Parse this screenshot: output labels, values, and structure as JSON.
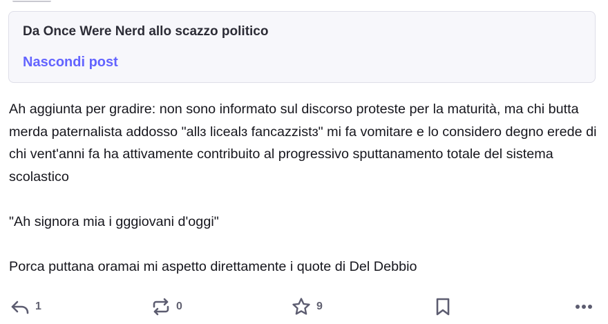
{
  "content_warning": {
    "text": "Da Once Were Nerd allo scazzo politico",
    "toggle_label": "Nascondi post"
  },
  "post": {
    "paragraphs": [
      "Ah aggiunta per gradire: non sono informato sul discorso proteste per la maturità, ma chi butta merda paternalista addosso \"allɜ licealɜ fancazzistɜ\" mi fa vomitare e lo considero degno erede di chi vent'anni fa ha attivamente contribuito al progressivo sputtanamento totale del sistema scolastico",
      "\"Ah signora mia i gggiovani d'oggi\"",
      "Porca puttana oramai mi aspetto direttamente i quote di Del Debbio"
    ]
  },
  "actions": {
    "reply": {
      "icon": "reply-icon",
      "count": "1"
    },
    "boost": {
      "icon": "boost-icon",
      "count": "0"
    },
    "favourite": {
      "icon": "star-icon",
      "count": "9"
    },
    "bookmark": {
      "icon": "bookmark-icon"
    },
    "more": {
      "icon": "more-horizontal-icon"
    }
  },
  "colors": {
    "accent": "#6364ff",
    "card_background": "#f7f7fb",
    "icon": "#5c5c70",
    "text": "#16161d"
  }
}
